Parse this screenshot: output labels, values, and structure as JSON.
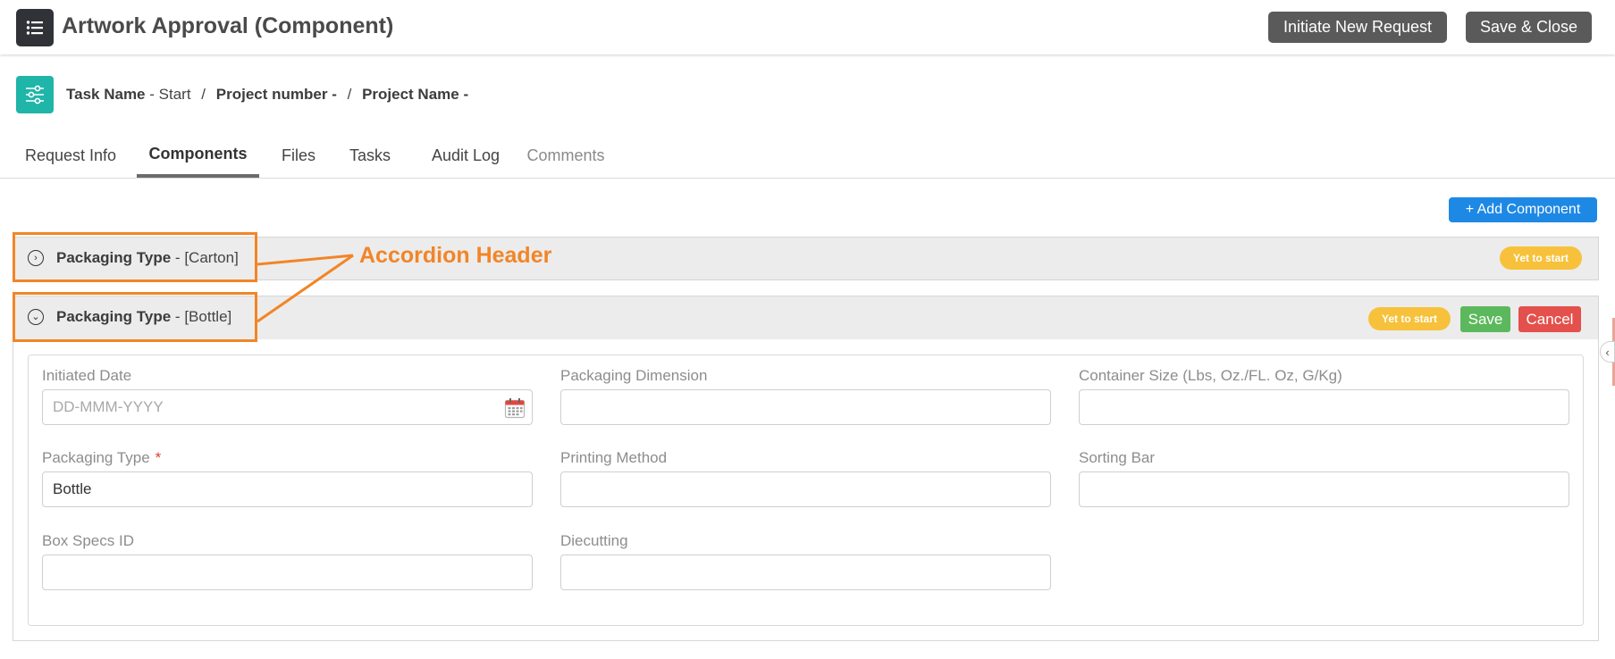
{
  "header": {
    "title": "Artwork Approval (Component)",
    "initiate_label": "Initiate New Request",
    "save_close_label": "Save & Close"
  },
  "breadcrumb": {
    "task_name_label": "Task Name",
    "task_name_value": "Start",
    "project_number_label": "Project number",
    "project_name_label": "Project Name",
    "dash": "-",
    "separator": "/"
  },
  "tabs": [
    {
      "label": "Request Info",
      "active": false
    },
    {
      "label": "Components",
      "active": true
    },
    {
      "label": "Files",
      "active": false
    },
    {
      "label": "Tasks",
      "active": false
    },
    {
      "label": "Audit Log",
      "active": false
    },
    {
      "label": "Comments",
      "active": false
    }
  ],
  "add_component_label": "+ Add Component",
  "accordions": [
    {
      "label": "Packaging Type",
      "value": "[Carton]",
      "status": "Yet to start",
      "expanded": false
    },
    {
      "label": "Packaging Type",
      "value": "[Bottle]",
      "status": "Yet to start",
      "expanded": true,
      "save_label": "Save",
      "cancel_label": "Cancel"
    }
  ],
  "form": {
    "initiated_date": {
      "label": "Initiated Date",
      "placeholder": "DD-MMM-YYYY",
      "value": ""
    },
    "packaging_dimension": {
      "label": "Packaging Dimension",
      "value": ""
    },
    "container_size": {
      "label": "Container Size (Lbs, Oz./FL. Oz, G/Kg)",
      "value": ""
    },
    "packaging_type": {
      "label": "Packaging Type",
      "required_mark": "*",
      "value": "Bottle"
    },
    "printing_method": {
      "label": "Printing Method",
      "value": ""
    },
    "sorting_bar": {
      "label": "Sorting Bar",
      "value": ""
    },
    "box_specs_id": {
      "label": "Box Specs ID",
      "value": ""
    },
    "diecutting": {
      "label": "Diecutting",
      "value": ""
    }
  },
  "annotation": {
    "text": "Accordion Header",
    "color": "#f28527"
  },
  "colors": {
    "teal_accent": "#1fb5a8",
    "primary_blue": "#1e88e5",
    "badge_yellow": "#f7c13b",
    "save_green": "#5cb85c",
    "cancel_red": "#e4504c",
    "dark_button": "#5a5a5a"
  }
}
